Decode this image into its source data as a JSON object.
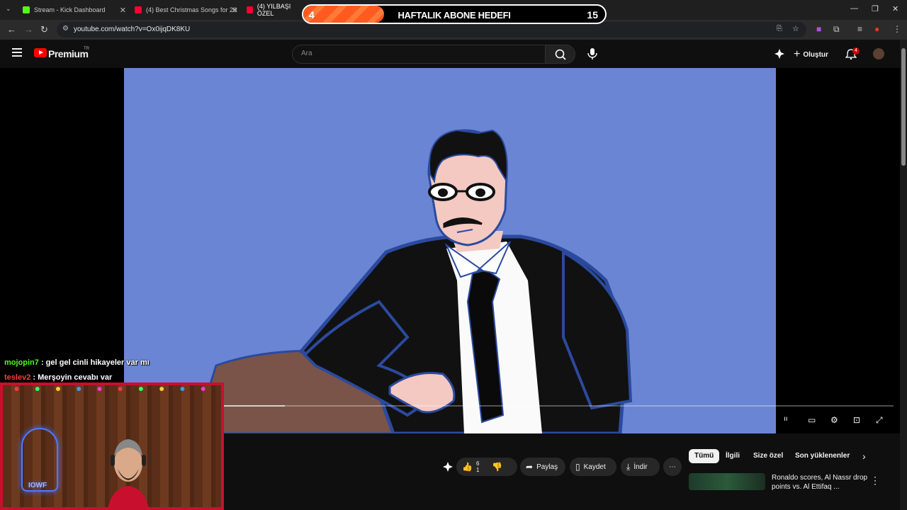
{
  "browser": {
    "tabs": [
      {
        "title": "Stream - Kick Dashboard",
        "favicon_color": "#53fc18"
      },
      {
        "title": "(4) Best Christmas Songs for 20",
        "favicon_color": "#ff0033"
      },
      {
        "title": "(4) YILBAŞI ÖZEL",
        "favicon_color": "#ff0033"
      }
    ],
    "url": "youtube.com/watch?v=Ox0ijqDK8KU"
  },
  "youtube": {
    "brand": "Premium",
    "region": "TR",
    "search_placeholder": "Ara",
    "create_label": "Oluştur",
    "notification_count": "4"
  },
  "video": {
    "progress": 0.2,
    "background_color": "#6a85d4"
  },
  "actions": {
    "like_count_top": "6",
    "like_count_bottom": "1",
    "share_label": "Paylaş",
    "save_label": "Kaydet",
    "download_label": "İndir"
  },
  "chips": {
    "all": "Tümü",
    "related": "İlgili",
    "for_you": "Size özel",
    "recent": "Son yüklenenler"
  },
  "recommendation": {
    "title": "Ronaldo scores, Al Nassr drop points vs. Al Ettifaq ..."
  },
  "goal": {
    "current": "4",
    "title": "HAFTALIK ABONE HEDEFI",
    "target": "15",
    "progress": 0.267
  },
  "chat": [
    {
      "user": "mojopin7",
      "message": " : gel gel cinli hikayeler var mı"
    },
    {
      "user": "teslev2",
      "message": " : Merşoyin cevabı var"
    }
  ],
  "webcam": {
    "neon_text": "IOWF"
  }
}
